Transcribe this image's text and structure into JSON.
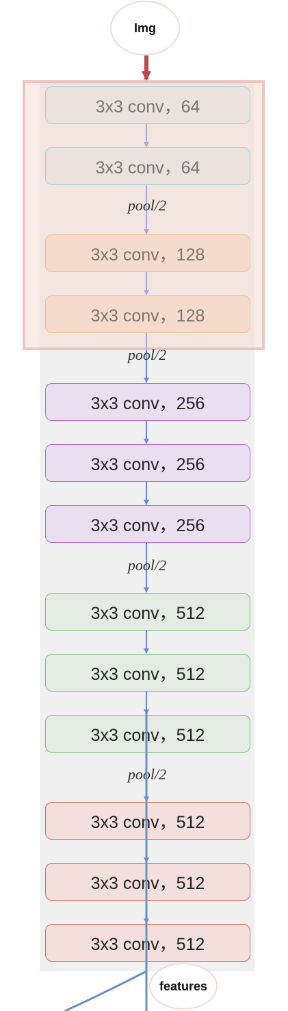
{
  "input": {
    "label": "Img"
  },
  "output": {
    "label": "features"
  },
  "pool_label": "pool/2",
  "colors": {
    "input_arrow": "#b94a4a",
    "flow_arrow": "#6b84e3",
    "feature_line": "#6b8fc7",
    "group1": {
      "fill": "#e3e9ec",
      "stroke": "#62c9e3"
    },
    "group2": {
      "fill": "#f5dfcd",
      "stroke": "#efb15b"
    },
    "group3": {
      "fill": "#eadff1",
      "stroke": "#b46ee6"
    },
    "group4": {
      "fill": "#e3ebe2",
      "stroke": "#7cc37a"
    },
    "group5": {
      "fill": "#f3dfdb",
      "stroke": "#e46c55"
    }
  },
  "layers": [
    {
      "label": "3x3 conv，64",
      "group": "group1"
    },
    {
      "label": "3x3 conv，64",
      "group": "group1"
    },
    {
      "label": "3x3 conv，128",
      "group": "group2"
    },
    {
      "label": "3x3 conv，128",
      "group": "group2"
    },
    {
      "label": "3x3 conv，256",
      "group": "group3"
    },
    {
      "label": "3x3 conv，256",
      "group": "group3"
    },
    {
      "label": "3x3 conv，256",
      "group": "group3"
    },
    {
      "label": "3x3 conv，512",
      "group": "group4"
    },
    {
      "label": "3x3 conv，512",
      "group": "group4"
    },
    {
      "label": "3x3 conv，512",
      "group": "group4"
    },
    {
      "label": "3x3 conv，512",
      "group": "group5"
    },
    {
      "label": "3x3 conv，512",
      "group": "group5"
    },
    {
      "label": "3x3 conv，512",
      "group": "group5"
    }
  ]
}
